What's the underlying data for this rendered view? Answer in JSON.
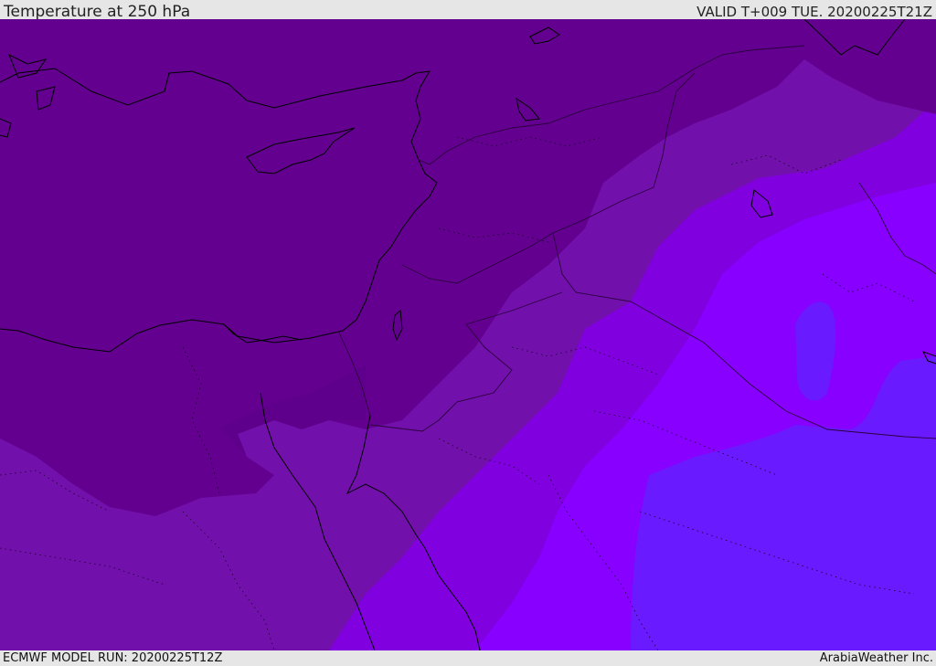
{
  "header": {
    "title": "Temperature at 250 hPa",
    "valid_time": "VALID T+009 TUE. 20200225T21Z"
  },
  "footer": {
    "model_run": "ECMWF MODEL RUN: 20200225T12Z",
    "credit": "ArabiaWeather Inc."
  },
  "map": {
    "variable": "Temperature",
    "level": "250 hPa",
    "colors": {
      "band_darkest": "#63008f",
      "band_dark": "#7210ab",
      "band_mid": "#7f00d8",
      "band_bright": "#8a00ff",
      "band_blue": "#6a16ff",
      "coastline": "#000000",
      "border": "#1a0033"
    }
  }
}
